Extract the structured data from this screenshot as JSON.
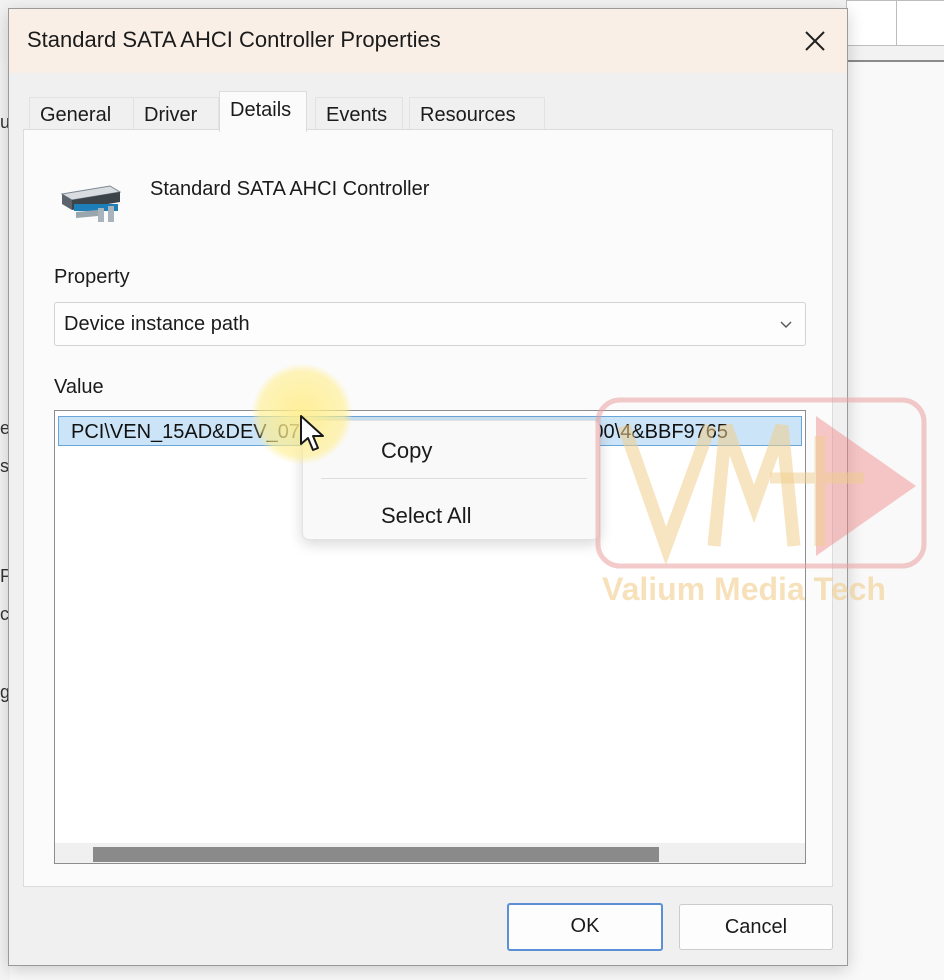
{
  "dialog": {
    "title": "Standard SATA AHCI Controller Properties",
    "close_label": "✕"
  },
  "tabs": [
    {
      "label": "General"
    },
    {
      "label": "Driver"
    },
    {
      "label": "Details",
      "active": true
    },
    {
      "label": "Events"
    },
    {
      "label": "Resources"
    }
  ],
  "device": {
    "name": "Standard SATA AHCI Controller",
    "icon": "storage-controller-icon"
  },
  "property": {
    "label": "Property",
    "selected": "Device instance path"
  },
  "value": {
    "label": "Value",
    "items": [
      "PCI\\VEN_15AD&DEV_07E0&SUBSYS_07E015AD&REV_00\\4&BBF9765"
    ]
  },
  "context_menu": {
    "items": [
      {
        "label": "Copy"
      },
      {
        "label": "Select All"
      }
    ]
  },
  "buttons": {
    "ok": "OK",
    "cancel": "Cancel"
  },
  "watermark": {
    "logo_text": "VMT",
    "brand": "Valium Media Tech"
  },
  "background_fragments": [
    "u",
    "es",
    "s",
    "P",
    "c",
    "g"
  ],
  "colors": {
    "title_bar": "#f9efe6",
    "selection": "#cce4f7",
    "primary_border": "#5b8fd6"
  }
}
